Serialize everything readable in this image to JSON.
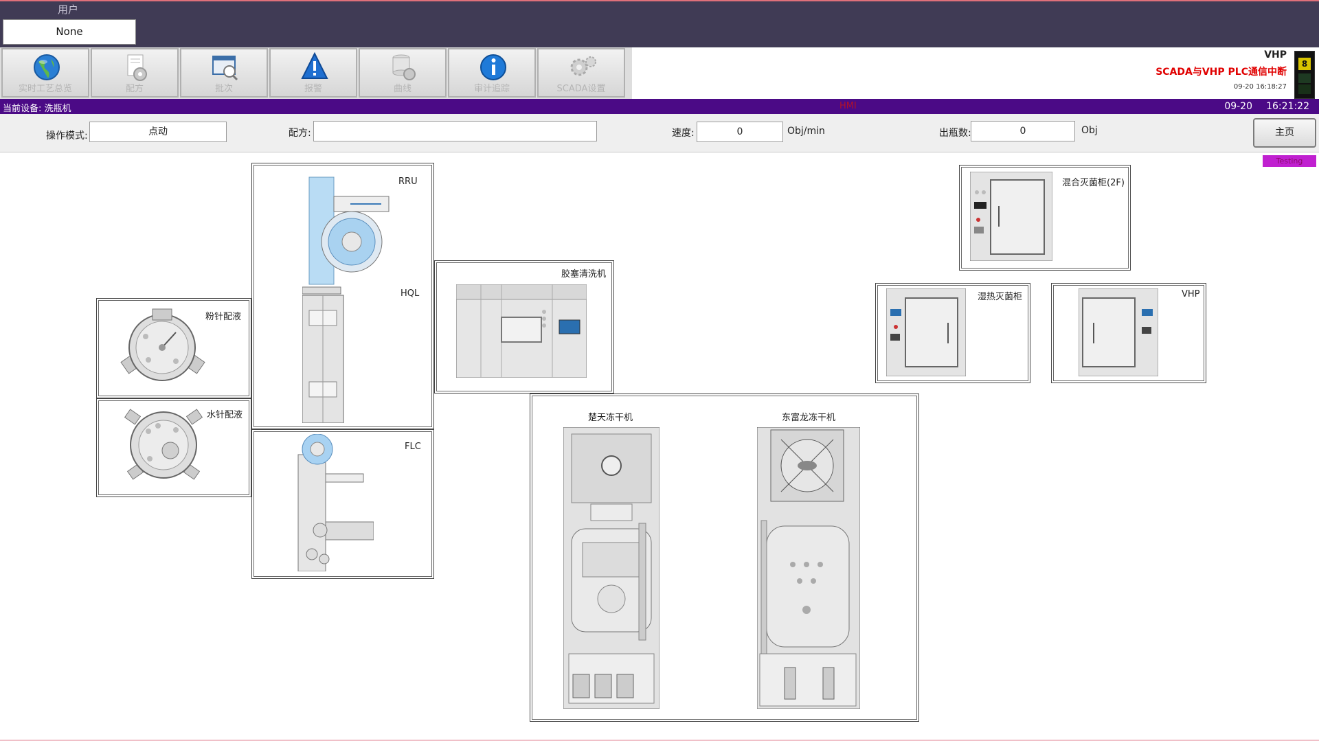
{
  "header": {
    "user_label": "用户",
    "user_value": "None"
  },
  "toolbar": {
    "buttons": [
      {
        "label": "实时工艺总览",
        "icon": "globe-icon"
      },
      {
        "label": "配方",
        "icon": "recipe-gear-icon"
      },
      {
        "label": "批次",
        "icon": "batch-search-icon"
      },
      {
        "label": "报警",
        "icon": "alarm-warning-icon"
      },
      {
        "label": "曲线",
        "icon": "curve-database-icon"
      },
      {
        "label": "审计追踪",
        "icon": "info-icon"
      },
      {
        "label": "SCADA设置",
        "icon": "gears-icon"
      }
    ]
  },
  "status": {
    "title": "VHP",
    "message": "SCADA与VHP PLC通信中断",
    "time": "09-20  16:18:27",
    "alarm_count": "8"
  },
  "device_bar": {
    "current_device": "当前设备: 洗瓶机",
    "center_text": "HMI",
    "date": "09-20",
    "time": "16:21:22"
  },
  "params": {
    "mode_label": "操作模式:",
    "mode_value": "点动",
    "recipe_label": "配方:",
    "recipe_value": "",
    "speed_label": "速度:",
    "speed_value": "0",
    "speed_unit": "Obj/min",
    "output_label": "出瓶数:",
    "output_value": "0",
    "output_unit": "Obj",
    "home_label": "主页",
    "tag": "Testing"
  },
  "machines": {
    "rru": "RRU",
    "hql": "HQL",
    "flc": "FLC",
    "powder": "粉针配液",
    "water": "水针配液",
    "stopper_washer": "胶塞清洗机",
    "hybrid_sterilizer": "混合灭菌柜(2F)",
    "moist_heat": "湿热灭菌柜",
    "vhp": "VHP",
    "freeze_dryer_1": "楚天冻干机",
    "freeze_dryer_2": "东富龙冻干机"
  },
  "colors": {
    "topbar": "#403b55",
    "device_bar": "#4b0a86",
    "alarm_red": "#e00000",
    "tag_magenta": "#c020d0"
  }
}
